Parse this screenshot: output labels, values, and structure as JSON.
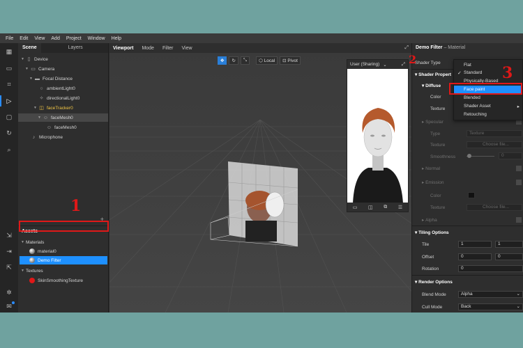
{
  "menubar": [
    "File",
    "Edit",
    "View",
    "Add",
    "Project",
    "Window",
    "Help"
  ],
  "scene": {
    "tabs": [
      "Scene",
      "Layers"
    ],
    "tree": [
      {
        "label": "Device",
        "icon": "device-icon"
      },
      {
        "label": "Camera",
        "icon": "camera-icon"
      },
      {
        "label": "Focal Distance",
        "icon": "focal-distance-icon"
      },
      {
        "label": "ambientLight0",
        "icon": "light-icon"
      },
      {
        "label": "directionalLight0",
        "icon": "light-icon"
      },
      {
        "label": "faceTracker0",
        "icon": "face-tracker-icon"
      },
      {
        "label": "faceMesh0",
        "icon": "face-mesh-icon"
      },
      {
        "label": "faceMesh0",
        "icon": "face-mesh-icon"
      },
      {
        "label": "Microphone",
        "icon": "microphone-icon"
      }
    ],
    "add_label": "+"
  },
  "assets": {
    "title": "Assets",
    "materials_label": "Materials",
    "material0": "material0",
    "demo_filter": "Demo Filter",
    "textures_label": "Textures",
    "texture0": "SkinSmoothingTexture"
  },
  "viewport": {
    "tabs": [
      "Viewport",
      "Mode",
      "Filter",
      "View"
    ],
    "local_label": "Local",
    "pivot_label": "Pivot",
    "preview_label": "User (Sharing)"
  },
  "inspector": {
    "title": "Demo Filter",
    "subtitle": "– Material",
    "shader_type_label": "Shader Type",
    "shader_properties": "Shader Propert",
    "diffuse": "Diffuse",
    "color": "Color",
    "texture": "Texture",
    "specular": "Specular",
    "type": "Type",
    "type_value": "Texture",
    "spec_texture": "Texture",
    "choose_file": "Choose file...",
    "smoothness": "Smoothness",
    "smoothness_value": "0",
    "normal": "Normal",
    "emission": "Emission",
    "em_color": "Color",
    "em_texture": "Texture",
    "em_choose_file": "Choose file...",
    "alpha": "Alpha",
    "tiling_options": "Tiling Options",
    "tile": "Tile",
    "tile_x": "1",
    "tile_y": "1",
    "offset": "Offset",
    "offset_x": "0",
    "offset_y": "0",
    "rotation": "Rotation",
    "rotation_value": "0",
    "render_options": "Render Options",
    "blend_mode": "Blend Mode",
    "blend_mode_value": "Alpha",
    "cull_mode": "Cull Mode",
    "cull_mode_value": "Back"
  },
  "shader_dropdown": {
    "options": [
      "Flat",
      "Standard",
      "Physically-Based",
      "Face paint",
      "Blended",
      "Shader Asset",
      "Retouching"
    ],
    "checked": "Standard",
    "highlighted": "Face paint"
  },
  "annotations": [
    "1",
    "2",
    "3"
  ],
  "colors": {
    "accent": "#1e90ff",
    "annotation": "#e01818",
    "tracker": "#f3c744"
  }
}
